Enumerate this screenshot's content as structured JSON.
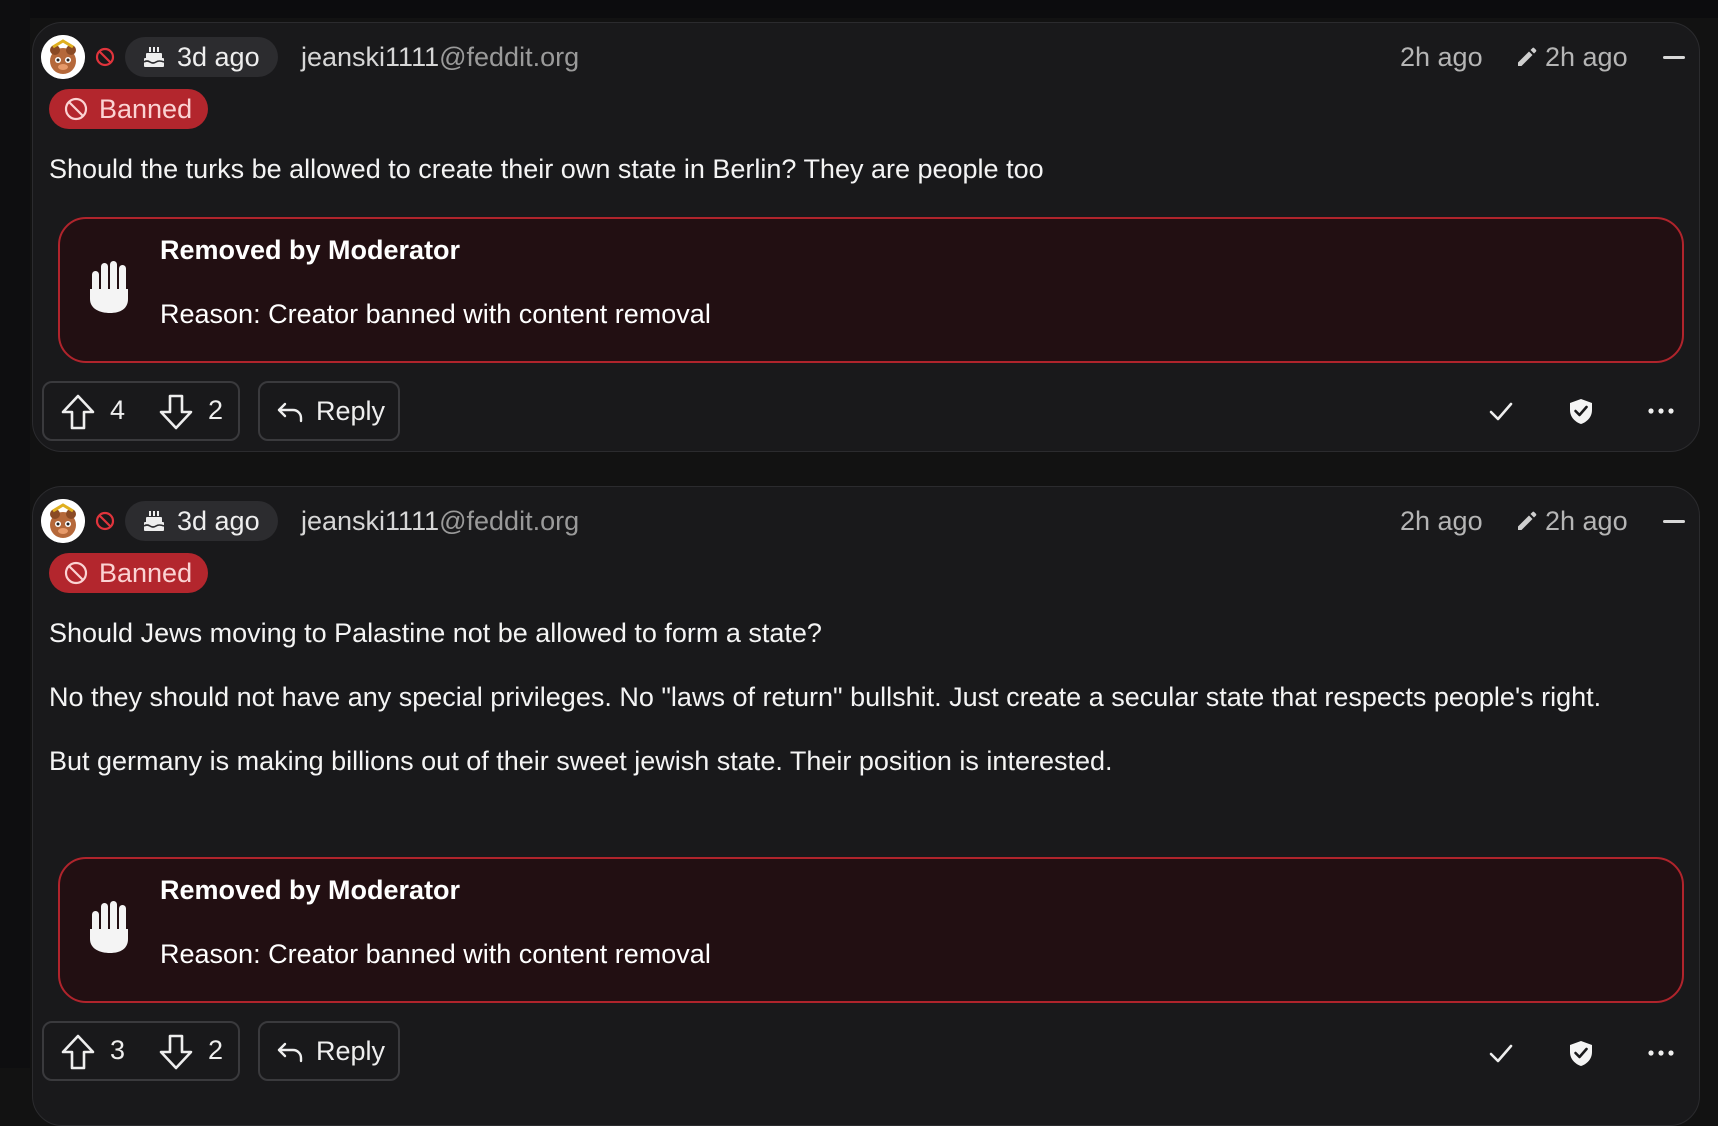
{
  "comments": [
    {
      "cake_age": "3d ago",
      "user_name": "jeanski1111",
      "instance": "@feddit.org",
      "published": "2h ago",
      "edited": "2h ago",
      "badge": "Banned",
      "paragraphs": [
        "Should the turks be allowed to create their own state in Berlin? They are people too"
      ],
      "removed_title": "Removed by Moderator",
      "removed_reason_label": "Reason:",
      "removed_reason": " Creator banned with content removal",
      "upvotes": "4",
      "downvotes": "2",
      "reply_label": "Reply"
    },
    {
      "cake_age": "3d ago",
      "user_name": "jeanski1111",
      "instance": "@feddit.org",
      "published": "2h ago",
      "edited": "2h ago",
      "badge": "Banned",
      "paragraphs": [
        "Should Jews moving to Palastine not be allowed to form a state?",
        "No they should not have any special privileges. No \"laws of return\" bullshit. Just create a secular state that respects people's right.",
        "But germany is making billions out of their sweet jewish state. Their position is interested."
      ],
      "removed_title": "Removed by Moderator",
      "removed_reason_label": "Reason:",
      "removed_reason": " Creator banned with content removal",
      "upvotes": "3",
      "downvotes": "2",
      "reply_label": "Reply"
    }
  ],
  "colors": {
    "background": "#121212",
    "card": "#19191b",
    "banned_badge": "#b3262d",
    "removed_box_bg": "#220f12",
    "removed_box_border": "#b0242c"
  },
  "icons": [
    "avatar",
    "ban-icon",
    "cake-icon",
    "pencil-icon",
    "collapse-icon",
    "hand-icon",
    "upvote-icon",
    "downvote-icon",
    "reply-icon",
    "check-icon",
    "shield-icon",
    "more-icon"
  ]
}
